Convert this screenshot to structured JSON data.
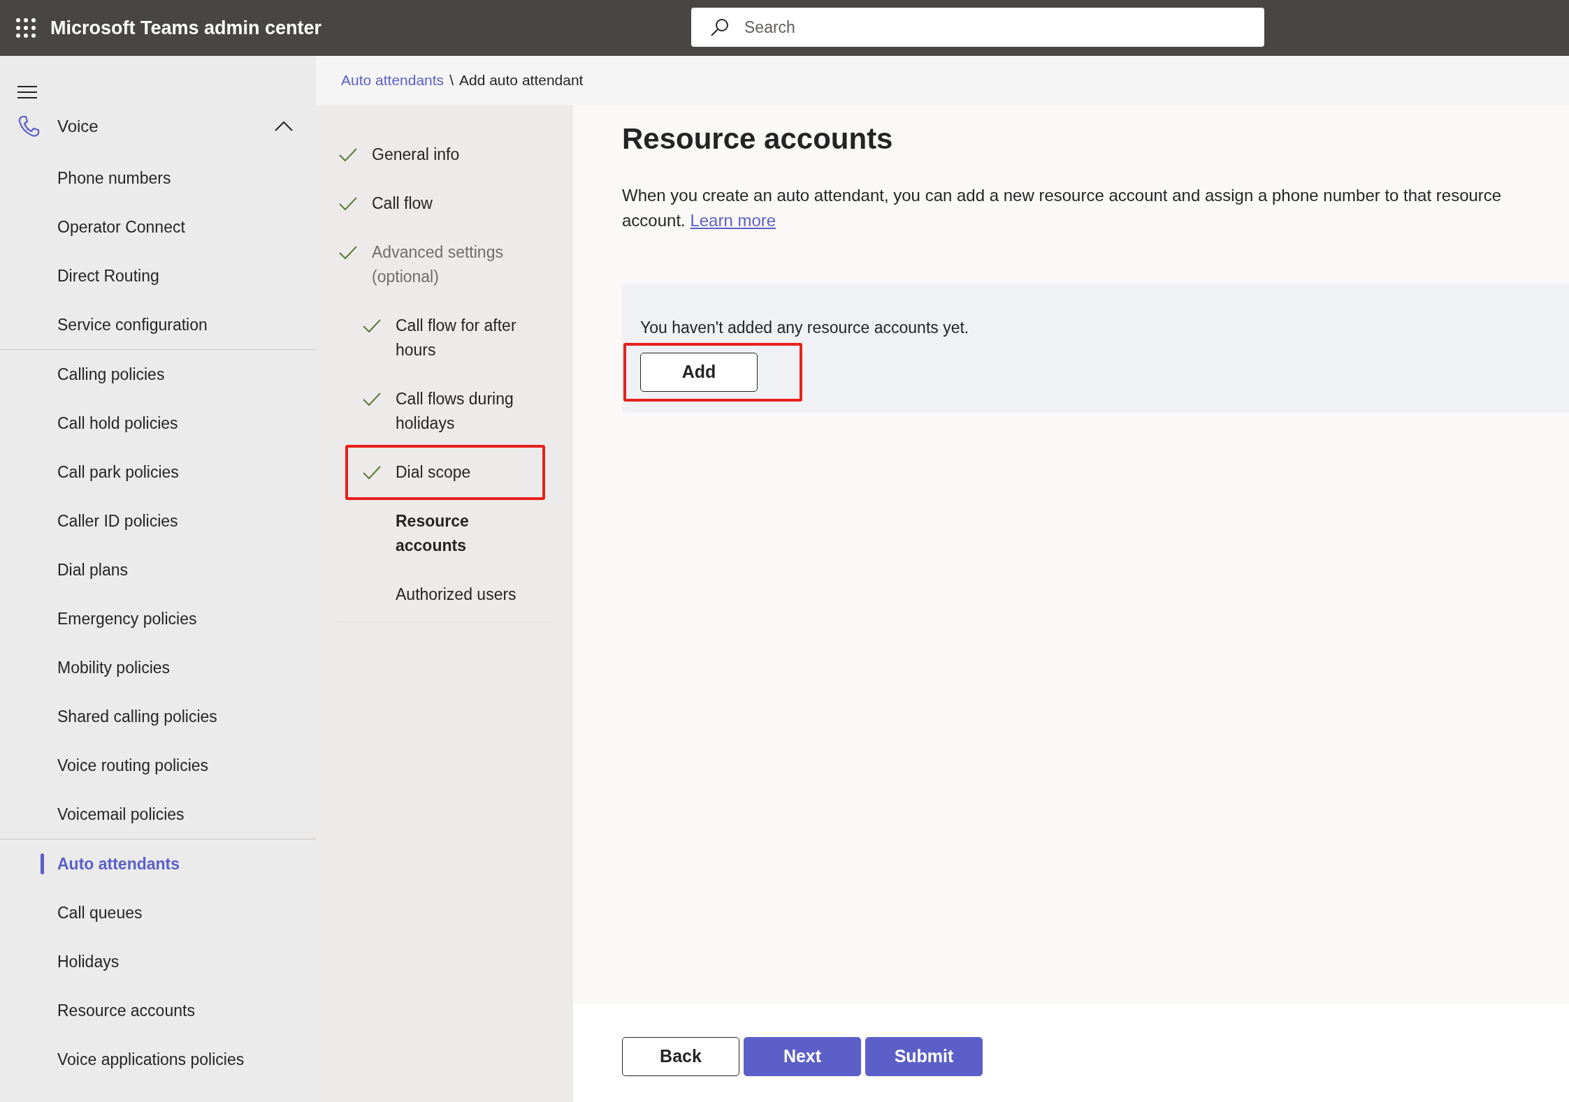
{
  "header": {
    "title": "Microsoft Teams admin center",
    "search": {
      "placeholder": "Search"
    }
  },
  "sidebar": {
    "section": {
      "label": "Voice",
      "expanded": true
    },
    "groups": [
      [
        {
          "label": "Phone numbers",
          "selected": false
        },
        {
          "label": "Operator Connect",
          "selected": false
        },
        {
          "label": "Direct Routing",
          "selected": false
        },
        {
          "label": "Service configuration",
          "selected": false
        }
      ],
      [
        {
          "label": "Calling policies",
          "selected": false
        },
        {
          "label": "Call hold policies",
          "selected": false
        },
        {
          "label": "Call park policies",
          "selected": false
        },
        {
          "label": "Caller ID policies",
          "selected": false
        },
        {
          "label": "Dial plans",
          "selected": false
        },
        {
          "label": "Emergency policies",
          "selected": false
        },
        {
          "label": "Mobility policies",
          "selected": false
        },
        {
          "label": "Shared calling policies",
          "selected": false
        },
        {
          "label": "Voice routing policies",
          "selected": false
        },
        {
          "label": "Voicemail policies",
          "selected": false
        }
      ],
      [
        {
          "label": "Auto attendants",
          "selected": true
        },
        {
          "label": "Call queues",
          "selected": false
        },
        {
          "label": "Holidays",
          "selected": false
        },
        {
          "label": "Resource accounts",
          "selected": false
        },
        {
          "label": "Voice applications policies",
          "selected": false
        }
      ]
    ]
  },
  "breadcrumb": [
    {
      "label": "Auto attendants",
      "kind": "link"
    },
    {
      "label": "\\",
      "kind": "separator"
    },
    {
      "label": "Add auto attendant",
      "kind": "current"
    }
  ],
  "steps": [
    {
      "label": "General info",
      "done": true,
      "selected": false,
      "highlighted": false
    },
    {
      "label": "Call flow",
      "done": true,
      "selected": false,
      "highlighted": false
    },
    {
      "label": "Advanced settings (optional)",
      "done": true,
      "selected": false,
      "highlighted": false,
      "children": [
        {
          "label": "Call flow for after hours",
          "done": true,
          "selected": false,
          "highlighted": false
        },
        {
          "label": "Call flows during holidays",
          "done": true,
          "selected": false,
          "highlighted": false
        },
        {
          "label": "Dial scope",
          "done": true,
          "selected": false,
          "highlighted": true
        },
        {
          "label": "Resource accounts",
          "done": false,
          "selected": true,
          "highlighted": false
        },
        {
          "label": "Authorized users",
          "done": false,
          "selected": false,
          "highlighted": false
        }
      ]
    }
  ],
  "content": {
    "title": "Resource accounts",
    "description": "When you create an auto attendant, you can add a new resource account and assign a phone number to that resource account.",
    "link": "Learn more",
    "empty_panel": {
      "message": "You haven't added any resource accounts yet.",
      "button": {
        "label": "Add",
        "highlighted": true
      }
    }
  },
  "footer": {
    "buttons": [
      {
        "label": "Back",
        "kind": "secondary"
      },
      {
        "label": "Next",
        "kind": "primary"
      },
      {
        "label": "Submit",
        "kind": "primary"
      }
    ]
  }
}
